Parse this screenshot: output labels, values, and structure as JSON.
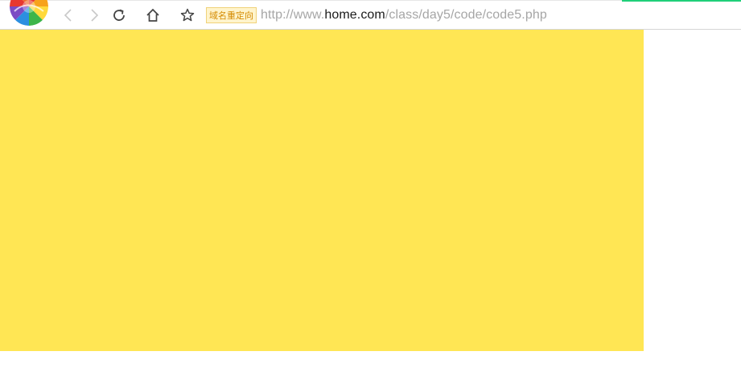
{
  "toolbar": {
    "back_icon": "chevron-left-icon",
    "forward_icon": "chevron-right-icon",
    "reload_icon": "reload-icon",
    "home_icon": "home-icon",
    "bookmark_icon": "star-icon",
    "logo_icon": "browser-logo-icon",
    "progress_color": "#1fcf79"
  },
  "address_bar": {
    "redirect_badge": "域名重定向",
    "url_scheme_prefix": "http://www.",
    "url_host": "home.com",
    "url_path": "/class/day5/code/code5.php"
  },
  "page": {
    "box_color": "#ffe654",
    "background_color": "#ffffff"
  }
}
